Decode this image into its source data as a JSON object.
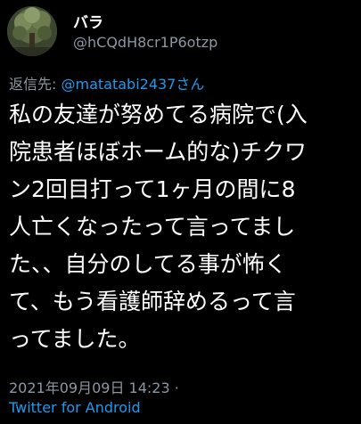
{
  "user": {
    "display_name": "バラ",
    "handle": "@hCQdH8cr1P6otzp"
  },
  "reply": {
    "prefix": "返信先: ",
    "mention": "@matatabi2437さん"
  },
  "tweet": {
    "lines": [
      "私の友達が努めてる病院で(入",
      "院患者ほぼホーム的な)チクワ",
      "ン2回目打って1ヶ月の間に8",
      "人亡くなったって言ってまし",
      "た、、自分のしてる事が怖く",
      "て、もう看護師辞めるって言",
      "ってました。"
    ]
  },
  "meta": {
    "timestamp": "2021年09月09日 14:23 ·",
    "source": "Twitter for Android"
  },
  "colors": {
    "background": "#000000",
    "text": "#ffffff",
    "muted": "#8b98a5",
    "link": "#1d9bf0"
  },
  "icons": {
    "avatar": "tree-photo-avatar"
  }
}
